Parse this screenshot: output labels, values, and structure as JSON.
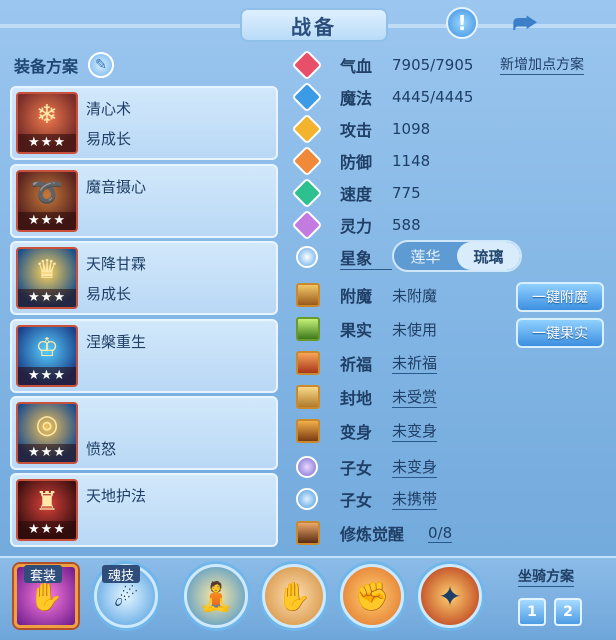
{
  "header": {
    "title": "战备",
    "info_icon": "exclamation-icon",
    "share_icon": "share-icon"
  },
  "equip": {
    "heading": "装备方案",
    "stars": "★★★",
    "slots": [
      {
        "name": "清心术",
        "sub": "易成长",
        "icon": "popsicle-icon"
      },
      {
        "name": "魔音摄心",
        "sub": "",
        "icon": "horn-icon"
      },
      {
        "name": "天降甘霖",
        "sub": "易成长",
        "icon": "gold-crown-icon"
      },
      {
        "name": "涅槃重生",
        "sub": "",
        "icon": "blue-crown-icon"
      },
      {
        "name": "",
        "sub": "愤怒",
        "icon": "belt-icon"
      },
      {
        "name": "天地护法",
        "sub": "",
        "icon": "red-robe-icon"
      }
    ]
  },
  "stats": {
    "add_points_label": "新增加点方案",
    "rows": [
      {
        "label": "气血",
        "value": "7905/7905",
        "color": "#e8506a"
      },
      {
        "label": "魔法",
        "value": "4445/4445",
        "color": "#3b9be6"
      },
      {
        "label": "攻击",
        "value": "1098",
        "color": "#f3b32d"
      },
      {
        "label": "防御",
        "value": "1148",
        "color": "#f0893a"
      },
      {
        "label": "速度",
        "value": "775",
        "color": "#2ec08f"
      },
      {
        "label": "灵力",
        "value": "588",
        "color": "#c47be0"
      }
    ],
    "star_label": "星象",
    "star_options": [
      "莲华",
      "琉璃"
    ],
    "star_selected": "琉璃"
  },
  "extras": {
    "rows": [
      {
        "label": "附魔",
        "value": "未附魔"
      },
      {
        "label": "果实",
        "value": "未使用"
      },
      {
        "label": "祈福",
        "value": "未祈福"
      },
      {
        "label": "封地",
        "value": "未受赏"
      },
      {
        "label": "变身",
        "value": "未变身"
      },
      {
        "label": "子女",
        "value": "未变身"
      },
      {
        "label": "子女",
        "value": "未携带"
      },
      {
        "label": "修炼觉醒",
        "value": "0/8"
      }
    ],
    "btn_enchant": "一键附魔",
    "btn_fruit": "一键果实"
  },
  "bottom": {
    "suit_label": "套装",
    "soul_label": "魂技",
    "mount_label": "坐骑方案",
    "mount_options": [
      "1",
      "2"
    ]
  }
}
